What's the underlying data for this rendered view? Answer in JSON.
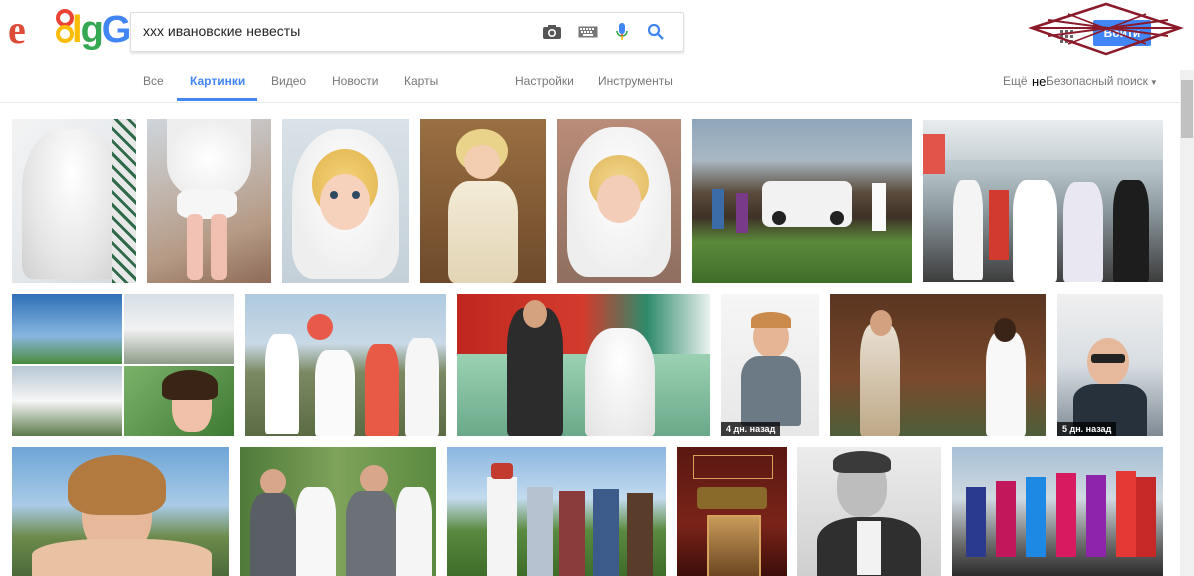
{
  "logo": {
    "e": "e",
    "o": "o",
    "rest_l": "l",
    "rest_g": "g",
    "rest_G": "G"
  },
  "search": {
    "query": "ххх ивановские невесты"
  },
  "icons": {
    "camera": "camera-icon",
    "keyboard": "keyboard-icon",
    "mic": "mic-icon",
    "search": "search-icon",
    "apps": "apps-grid-icon"
  },
  "header": {
    "signin_label": "Войти"
  },
  "tabs": [
    {
      "label": "Все",
      "active": false
    },
    {
      "label": "Картинки",
      "active": true
    },
    {
      "label": "Видео",
      "active": false
    },
    {
      "label": "Новости",
      "active": false
    },
    {
      "label": "Карты",
      "active": false
    },
    {
      "label": "Настройки",
      "active": false
    },
    {
      "label": "Инструменты",
      "active": false
    }
  ],
  "safesearch": {
    "prefix": "Ещё",
    "bold": "не",
    "label": "Безопасный поиск"
  },
  "images": [
    {
      "badge": ""
    },
    {
      "badge": ""
    },
    {
      "badge": ""
    },
    {
      "badge": ""
    },
    {
      "badge": ""
    },
    {
      "badge": ""
    },
    {
      "badge": ""
    },
    {
      "badge": ""
    },
    {
      "badge": ""
    },
    {
      "badge": ""
    },
    {
      "badge": "4 дн. назад"
    },
    {
      "badge": ""
    },
    {
      "badge": "5 дн. назад"
    },
    {
      "badge": ""
    },
    {
      "badge": ""
    },
    {
      "badge": ""
    },
    {
      "badge": ""
    },
    {
      "badge": ""
    },
    {
      "badge": ""
    }
  ],
  "colors": {
    "accent": "#4285f4",
    "logo_red": "#dd4b39",
    "logo_yellow": "#fbbc05",
    "logo_green": "#34a853",
    "scribble": "#8b1a2b"
  }
}
